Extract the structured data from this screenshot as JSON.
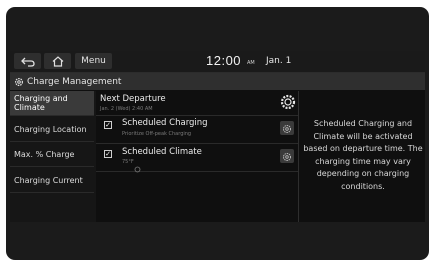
{
  "topbar": {
    "back_icon": "back-arrow-icon",
    "home_icon": "home-icon",
    "menu_label": "Menu",
    "time": "12:00",
    "ampm": "AM",
    "date": "Jan. 1"
  },
  "header": {
    "icon": "gear-icon",
    "title": "Charge Management"
  },
  "sidebar": {
    "items": [
      {
        "label": "Charging and Climate",
        "active": true
      },
      {
        "label": "Charging Location",
        "active": false
      },
      {
        "label": "Max. % Charge",
        "active": false
      },
      {
        "label": "Charging Current",
        "active": false
      }
    ]
  },
  "content": {
    "next_departure": {
      "title": "Next Departure",
      "subtitle": "Jan. 2 (Wed) 2:40 AM",
      "icon": "departure-settings-icon"
    },
    "scheduled_charging": {
      "title": "Scheduled Charging",
      "subtitle": "Prioritize Off-peak Charging",
      "checked": true,
      "icon": "settings-icon"
    },
    "scheduled_climate": {
      "title": "Scheduled Climate",
      "subtitle": "75°F",
      "checked": true,
      "icon": "settings-icon"
    }
  },
  "info": {
    "text": "Scheduled Charging and Climate will be activated based on departure time. The charging time may vary depending on charging conditions."
  },
  "colors": {
    "bezel": "#1b1b1b",
    "display": "#0f0f0f",
    "header": "#2f2f2f",
    "active_item": "#3a3a3a",
    "text": "#e4e4e4"
  }
}
